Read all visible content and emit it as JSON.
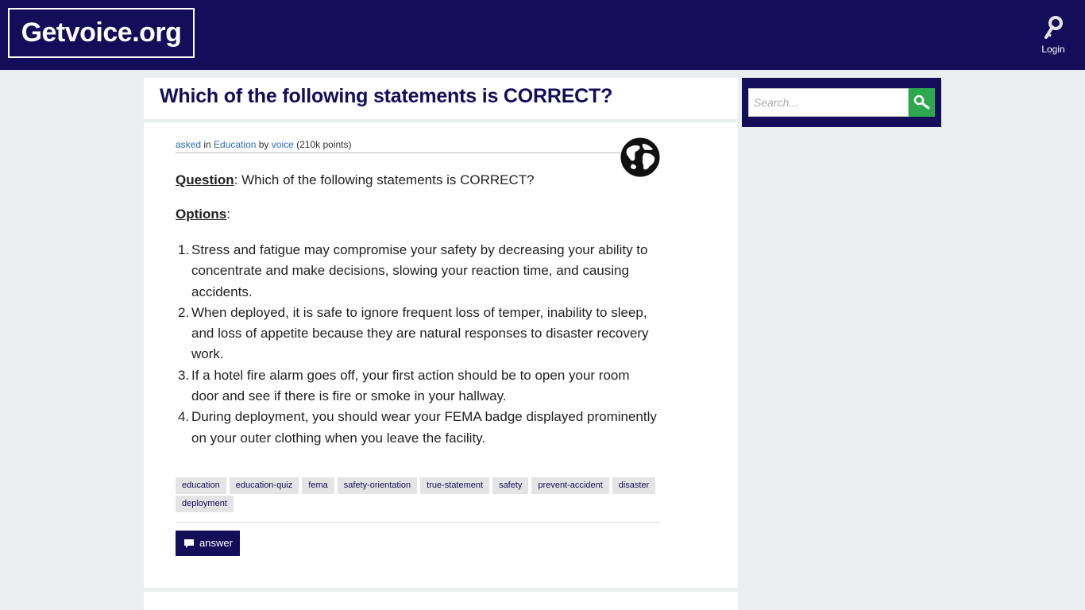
{
  "header": {
    "site_name": "Getvoice.org",
    "login_label": "Login",
    "login_icon": "key-icon",
    "background": "#140e5a"
  },
  "question": {
    "title": "Which of the following statements is CORRECT?",
    "meta": {
      "asked": "asked",
      "in_text": " in ",
      "category": "Education",
      "by_text": " by ",
      "user": "voice",
      "points": " (210k points)"
    },
    "avatar_icon": "globe-icon",
    "question_label": "Question",
    "question_text": ": Which of the following statements is CORRECT?",
    "options_label": "Options",
    "options_colon": ":",
    "options": [
      {
        "num": "1.",
        "text": "Stress and fatigue may compromise your safety by decreasing your ability to concentrate and make decisions, slowing your reaction time, and causing accidents."
      },
      {
        "num": "2.",
        "text": "When deployed, it is safe to ignore frequent loss of temper, inability to sleep, and loss of appetite because they are natural responses to disaster recovery work."
      },
      {
        "num": "3.",
        "text": "If a hotel fire alarm goes off, your first action should be to open your room door and see if there is fire or smoke in your hallway."
      },
      {
        "num": "4.",
        "text": "During deployment, you should wear your FEMA badge displayed prominently on your outer clothing when you leave the facility."
      }
    ],
    "tags": [
      "education",
      "education-quiz",
      "fema",
      "safety-orientation",
      "true-statement",
      "safety",
      "prevent-accident",
      "disaster",
      "deployment"
    ],
    "answer_label": "answer",
    "answer_icon": "comment-icon"
  },
  "search": {
    "placeholder": "Search...",
    "button_icon": "search-icon",
    "button_color": "#2ea84e"
  }
}
